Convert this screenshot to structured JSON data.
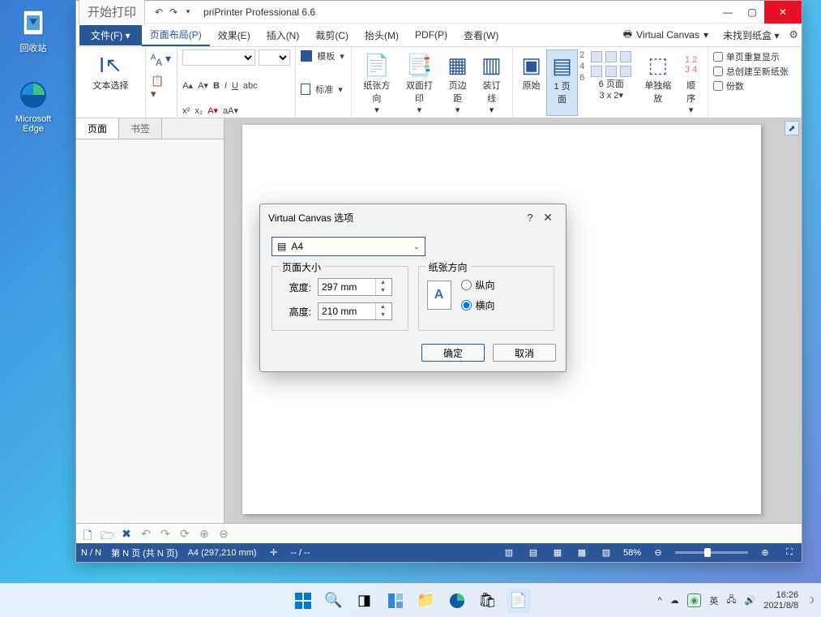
{
  "desktop": {
    "recycle": "回收站",
    "edge": "Microsoft\nEdge"
  },
  "window": {
    "start_print": "开始打印",
    "title": "priPrinter Professional 6.6"
  },
  "menu": {
    "file": "文件(F)",
    "layout": "页面布局(P)",
    "effects": "效果(E)",
    "insert": "插入(N)",
    "crop": "裁剪(C)",
    "head": "抬头(M)",
    "pdf": "PDF(P)",
    "view": "查看(W)",
    "printer": "Virtual Canvas",
    "tray": "未找到纸盒"
  },
  "ribbon": {
    "text_select": "文本选择",
    "template": "模板",
    "standard": "标准",
    "paper_orient": "纸张方向",
    "duplex": "双面打印",
    "page_margin": "页边距",
    "binding": "装订线",
    "original": "原始",
    "one_page": "1 页面",
    "six_page": "6 页面",
    "six_spec": "3 x 2",
    "scale_only": "单独缩放",
    "order": "顺序",
    "chk_repeat": "单页重复显示",
    "chk_always_new": "总创建至新纸张",
    "chk_copies": "份数"
  },
  "sidetabs": {
    "page": "页面",
    "bookmark": "书签"
  },
  "dialog": {
    "title": "Virtual Canvas 选项",
    "paper": "A4",
    "size_group": "页面大小",
    "width_label": "宽度:",
    "width_val": "297 mm",
    "height_label": "高度:",
    "height_val": "210 mm",
    "orient_group": "纸张方向",
    "portrait": "纵向",
    "landscape": "横向",
    "ok": "确定",
    "cancel": "取消"
  },
  "status": {
    "nn": "N / N",
    "page_of": "第 N 页 (共 N 页)",
    "paper": "A4 (297,210 mm)",
    "dash": "-- / --",
    "zoom": "58%"
  },
  "tray": {
    "ime": "英",
    "time": "16:26",
    "date": "2021/8/8"
  }
}
